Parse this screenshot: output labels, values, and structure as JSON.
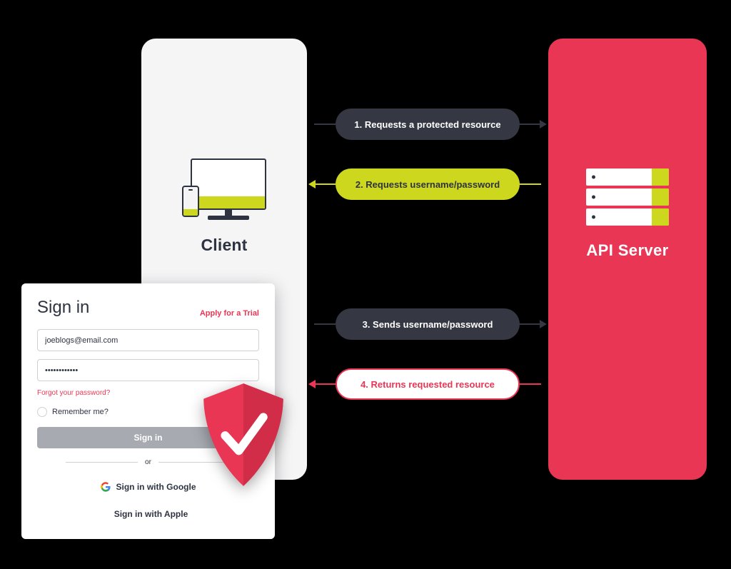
{
  "client": {
    "label": "Client"
  },
  "server": {
    "label": "API Server"
  },
  "flows": {
    "f1": "1. Requests a protected resource",
    "f2": "2. Requests username/password",
    "f3": "3. Sends username/password",
    "f4": "4. Returns requested resource"
  },
  "signin": {
    "title": "Sign in",
    "trial": "Apply for a Trial",
    "email_value": "joeblogs@email.com",
    "password_value": "••••••••••••",
    "forgot": "Forgot your password?",
    "remember": "Remember me?",
    "submit": "Sign in",
    "or": "or",
    "google": "Sign in with Google",
    "apple": "Sign in with Apple"
  }
}
